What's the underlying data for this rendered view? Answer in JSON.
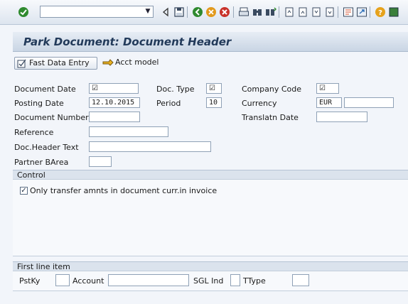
{
  "colors": {
    "accent": "#223a5a",
    "toolbar_bg": "#dde5ef",
    "ok_green": "#2f8a2f",
    "cancel_red": "#c8322a"
  },
  "toolbar": {
    "icons": [
      "enter-icon",
      "back-triangle-icon",
      "save-icon",
      "back-icon",
      "exit-icon",
      "cancel-icon",
      "print-icon",
      "find-icon",
      "find-next-icon",
      "first-page-icon",
      "previous-page-icon",
      "next-page-icon",
      "last-page-icon",
      "create-session-icon",
      "shortcut-icon",
      "help-icon",
      "customize-icon"
    ],
    "command_value": ""
  },
  "header": {
    "title": "Park Document: Document Header"
  },
  "app_toolbar": {
    "fast_entry": "Fast Data Entry",
    "acct_model": "Acct model"
  },
  "form": {
    "document_date": {
      "label": "Document Date",
      "value": "☑"
    },
    "doc_type": {
      "label": "Doc. Type",
      "value": "☑"
    },
    "company_code": {
      "label": "Company Code",
      "value": "☑"
    },
    "posting_date": {
      "label": "Posting Date",
      "value": "12.10.2015"
    },
    "period": {
      "label": "Period",
      "value": "10"
    },
    "currency": {
      "label": "Currency",
      "value": "EUR",
      "extra": ""
    },
    "document_number": {
      "label": "Document Number",
      "value": ""
    },
    "translatn_date": {
      "label": "Translatn Date",
      "value": ""
    },
    "reference": {
      "label": "Reference",
      "value": ""
    },
    "doc_header_text": {
      "label": "Doc.Header Text",
      "value": ""
    },
    "partner_barea": {
      "label": "Partner BArea",
      "value": ""
    }
  },
  "control": {
    "title": "Control",
    "only_transfer": {
      "label": "Only transfer amnts in document curr.in invoice",
      "checked": true,
      "mark": "✓"
    }
  },
  "first_line": {
    "title": "First line item",
    "pstky": {
      "label": "PstKy",
      "value": ""
    },
    "account": {
      "label": "Account",
      "value": ""
    },
    "sgl_ind": {
      "label": "SGL Ind",
      "value": ""
    },
    "ttype": {
      "label": "TType",
      "value": ""
    }
  }
}
